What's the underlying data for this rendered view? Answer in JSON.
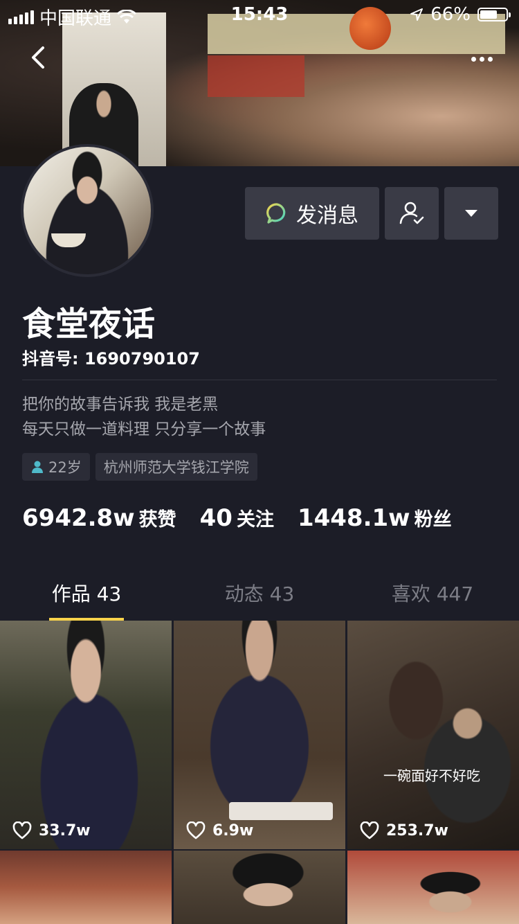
{
  "status_bar": {
    "carrier": "中国联通",
    "time": "15:43",
    "battery": "66%",
    "battery_level": 0.66
  },
  "header": {
    "back_icon": "chevron-left-icon",
    "more_icon": "more-horizontal-icon"
  },
  "actions": {
    "message_label": "发消息",
    "message_icon": "chat-bubble-icon",
    "follow_icon": "user-check-icon",
    "dropdown_icon": "caret-down-icon"
  },
  "profile": {
    "name": "食堂夜话",
    "douyin_id": "抖音号: 1690790107",
    "bio_lines": [
      "把你的故事告诉我 我是老黑",
      "每天只做一道料理 只分享一个故事"
    ],
    "tags": [
      "22岁",
      "杭州师范大学钱江学院"
    ]
  },
  "stats": [
    {
      "value": "6942.8w",
      "label": "获赞"
    },
    {
      "value": "40",
      "label": "关注"
    },
    {
      "value": "1448.1w",
      "label": "粉丝"
    }
  ],
  "tabs": [
    {
      "label": "作品 43",
      "active": true
    },
    {
      "label": "动态 43",
      "active": false
    },
    {
      "label": "喜欢 447",
      "active": false
    }
  ],
  "videos": [
    {
      "likes": "33.7w",
      "caption": ""
    },
    {
      "likes": "6.9w",
      "caption": ""
    },
    {
      "likes": "253.7w",
      "caption": "一碗面好不好吃"
    }
  ],
  "colors": {
    "background": "#1c1d27",
    "button_bg": "#3a3b46",
    "tab_indicator": "#f9d34b",
    "chat_icon_start": "#f5d54a",
    "chat_icon_end": "#3fd4c8"
  }
}
